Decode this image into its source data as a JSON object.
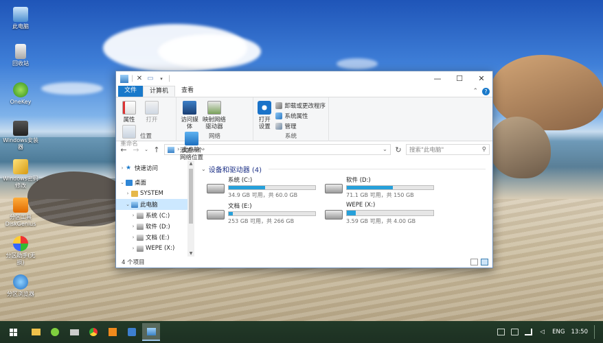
{
  "desktop": {
    "icons": [
      {
        "label": "此电脑",
        "icon": "computer-icon"
      },
      {
        "label": "回收站",
        "icon": "recycle-bin-icon"
      },
      {
        "label": "OneKey",
        "icon": "onekey-icon"
      },
      {
        "label": "Windows安装器",
        "icon": "windows-installer-icon"
      },
      {
        "label": "Windows密码修改",
        "icon": "key-icon"
      },
      {
        "label": "分区工具DiskGenius",
        "icon": "diskgenius-icon"
      },
      {
        "label": "分区助手(无损)",
        "icon": "partition-assistant-icon"
      },
      {
        "label": "分区浏览器",
        "icon": "ie-browser-icon"
      }
    ]
  },
  "window": {
    "title": "此电脑",
    "controls": {
      "minimize": "—",
      "maximize": "☐",
      "close": "✕"
    },
    "tabs": {
      "file": "文件",
      "computer": "计算机",
      "view": "查看"
    },
    "ribbon": {
      "location_group": {
        "label": "位置",
        "properties": "属性",
        "open": "打开",
        "rename": "重命名"
      },
      "network_group": {
        "label": "网络",
        "access_media": "访问媒体",
        "map_drive": "映射网络驱动器",
        "add_location": "添加一个网络位置"
      },
      "system_group": {
        "label": "系统",
        "open_settings": "打开设置",
        "uninstall": "卸载或更改程序",
        "system_properties": "系统属性",
        "manage": "管理"
      }
    },
    "address": {
      "path": "此电脑",
      "search_placeholder": "搜索\"此电脑\""
    },
    "nav_pane": [
      {
        "label": "快速访问",
        "arrow": "›",
        "icon": "star-icon"
      },
      {
        "label": "桌面",
        "arrow": "⌄",
        "icon": "desktop-folder-icon"
      },
      {
        "label": "SYSTEM",
        "arrow": "›",
        "icon": "user-folder-icon"
      },
      {
        "label": "此电脑",
        "arrow": "⌄",
        "icon": "computer-icon"
      },
      {
        "label": "系统 (C:)",
        "arrow": "›",
        "icon": "drive-icon"
      },
      {
        "label": "软件 (D:)",
        "arrow": "›",
        "icon": "drive-icon"
      },
      {
        "label": "文档 (E:)",
        "arrow": "›",
        "icon": "drive-icon"
      },
      {
        "label": "WEPE (X:)",
        "arrow": "›",
        "icon": "drive-icon"
      }
    ],
    "section_title": "设备和驱动器 (4)",
    "drives": [
      {
        "name": "系统 (C:)",
        "free": "34.9 GB 可用，共 60.0 GB",
        "used_fraction": 0.42
      },
      {
        "name": "软件 (D:)",
        "free": "71.1 GB 可用，共 150 GB",
        "used_fraction": 0.53
      },
      {
        "name": "文档 (E:)",
        "free": "253 GB 可用，共 266 GB",
        "used_fraction": 0.05
      },
      {
        "name": "WEPE (X:)",
        "free": "3.59 GB 可用，共 4.00 GB",
        "used_fraction": 0.1
      }
    ],
    "status": "4 个项目"
  },
  "taskbar": {
    "language": "ENG",
    "time": "13:50"
  },
  "colors": {
    "accent": "#1979ca",
    "drive_bar": "#26a0da",
    "taskbar": "#1e3324"
  }
}
